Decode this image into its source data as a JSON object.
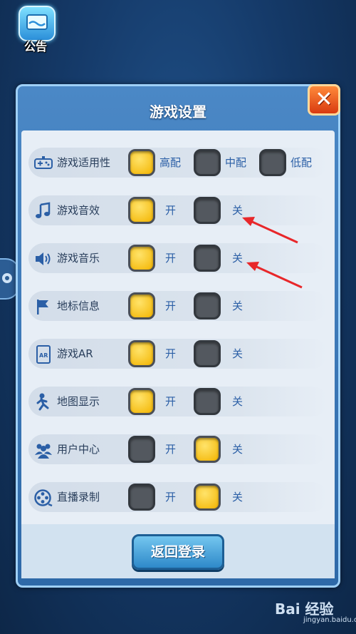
{
  "notice": {
    "label": "公告"
  },
  "panel": {
    "title": "游戏设置"
  },
  "rows": [
    {
      "label": "游戏适用性",
      "icon": "gamepad-icon",
      "options": [
        "高配",
        "中配",
        "低配"
      ],
      "selected": 0
    },
    {
      "label": "游戏音效",
      "icon": "music-note-icon",
      "options": [
        "开",
        "关"
      ],
      "selected": 0
    },
    {
      "label": "游戏音乐",
      "icon": "speaker-icon",
      "options": [
        "开",
        "关"
      ],
      "selected": 0
    },
    {
      "label": "地标信息",
      "icon": "flag-icon",
      "options": [
        "开",
        "关"
      ],
      "selected": 0
    },
    {
      "label": "游戏AR",
      "icon": "ar-icon",
      "options": [
        "开",
        "关"
      ],
      "selected": 0
    },
    {
      "label": "地图显示",
      "icon": "running-figure-icon",
      "options": [
        "开",
        "关"
      ],
      "selected": 0
    },
    {
      "label": "用户中心",
      "icon": "users-icon",
      "options": [
        "开",
        "关"
      ],
      "selected": 1
    },
    {
      "label": "直播录制",
      "icon": "film-reel-icon",
      "options": [
        "开",
        "关"
      ],
      "selected": 1
    }
  ],
  "footer": {
    "back_label": "返回登录"
  },
  "watermark": {
    "brand": "Bai 经验",
    "url": "jingyan.baidu.com"
  },
  "colors": {
    "on": "#f3b400",
    "off": "#53585f",
    "accent_text": "#2b5fa6",
    "annotation": "#e8272a"
  }
}
